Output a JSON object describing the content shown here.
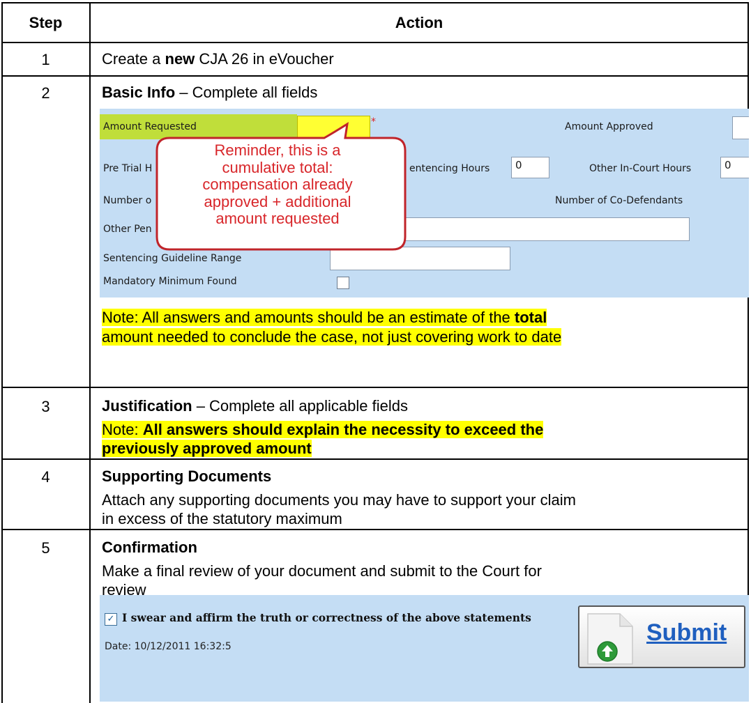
{
  "header": {
    "step": "Step",
    "action": "Action"
  },
  "rows": [
    {
      "num": "1",
      "pre": "Create a ",
      "bold": "new",
      "post": " CJA 26 in eVoucher"
    },
    {
      "num": "2",
      "title": "Basic Info",
      "title_rest": " – Complete all fields",
      "note_line1_pre": "Note: All answers and amounts should be an estimate of the ",
      "note_line1_bold": "total",
      "note_line2": "amount needed to conclude the case, not just covering work to date"
    },
    {
      "num": "3",
      "title": "Justification",
      "title_rest": " – Complete all applicable fields",
      "note_pre": "Note: ",
      "note_bold_1": "All answers should explain the necessity to exceed the",
      "note_bold_2": "previously approved amount"
    },
    {
      "num": "4",
      "title": "Supporting Documents",
      "body_1": "Attach any supporting documents you may have to support your claim",
      "body_2": "in excess of the statutory maximum"
    },
    {
      "num": "5",
      "title": "Confirmation",
      "body_1": "Make a final review of your document and submit to the Court for",
      "body_2": "review"
    }
  ],
  "basic_info_form": {
    "amount_requested_label": "Amount Requested",
    "amount_requested_value": "",
    "required_marker": "*",
    "amount_approved_label": "Amount Approved",
    "pre_trial_label_visible": "Pre Trial H",
    "sentencing_hours_label_visible": "entencing Hours",
    "sentencing_hours_value": "0",
    "other_in_court_hours_label": "Other In-Court Hours",
    "other_in_court_hours_value": "0",
    "number_of_label_visible": "Number o",
    "co_defendants_label": "Number of Co-Defendants",
    "other_pen_label_visible": "Other Pen",
    "sentencing_guideline_label": "Sentencing Guideline Range",
    "mandatory_minimum_label": "Mandatory Minimum Found"
  },
  "callout": {
    "lines": [
      "Reminder, this is a",
      "cumulative total:",
      "compensation already",
      "approved + additional",
      "amount requested"
    ],
    "text_color": "#d8262a",
    "border_color": "#c0242a"
  },
  "confirmation_form": {
    "affirm_text": "I swear and affirm the truth or correctness of the above statements",
    "affirm_checked": true,
    "date_text": "Date: 10/12/2011 16:32:5",
    "submit_label": "Submit"
  },
  "colors": {
    "highlight": "#ffff00",
    "form_bg": "#c4ddf4",
    "required_field_bg": "#c0de3a",
    "submit_text": "#1f5fbf"
  },
  "icons": {
    "check": "check-icon",
    "submit_doc": "document-icon",
    "submit_arrow": "green-up-arrow-icon"
  }
}
